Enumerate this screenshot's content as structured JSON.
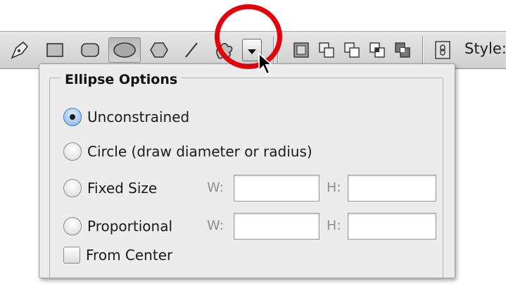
{
  "toolbar": {
    "tools": [
      {
        "name": "pen-tool-icon"
      },
      {
        "name": "rectangle-tool-icon"
      },
      {
        "name": "rounded-rectangle-tool-icon"
      },
      {
        "name": "ellipse-tool-icon",
        "selected": true
      },
      {
        "name": "polygon-tool-icon"
      },
      {
        "name": "line-tool-icon"
      },
      {
        "name": "custom-shape-tool-icon"
      }
    ],
    "style_label": "Style:"
  },
  "panel": {
    "title": "Ellipse Options",
    "options": {
      "unconstrained": {
        "label": "Unconstrained",
        "selected": true
      },
      "circle": {
        "label": "Circle (draw diameter or radius)",
        "selected": false
      },
      "fixed_size": {
        "label": "Fixed Size",
        "selected": false,
        "w_label": "W:",
        "h_label": "H:",
        "w_value": "",
        "h_value": ""
      },
      "proportional": {
        "label": "Proportional",
        "selected": false,
        "w_label": "W:",
        "h_label": "H:",
        "w_value": "",
        "h_value": ""
      },
      "from_center": {
        "label": "From Center",
        "checked": false
      }
    }
  },
  "colors": {
    "highlight": "#e2000b",
    "radio_selected": "#7eb2e8",
    "panel_bg": "#ececec"
  }
}
